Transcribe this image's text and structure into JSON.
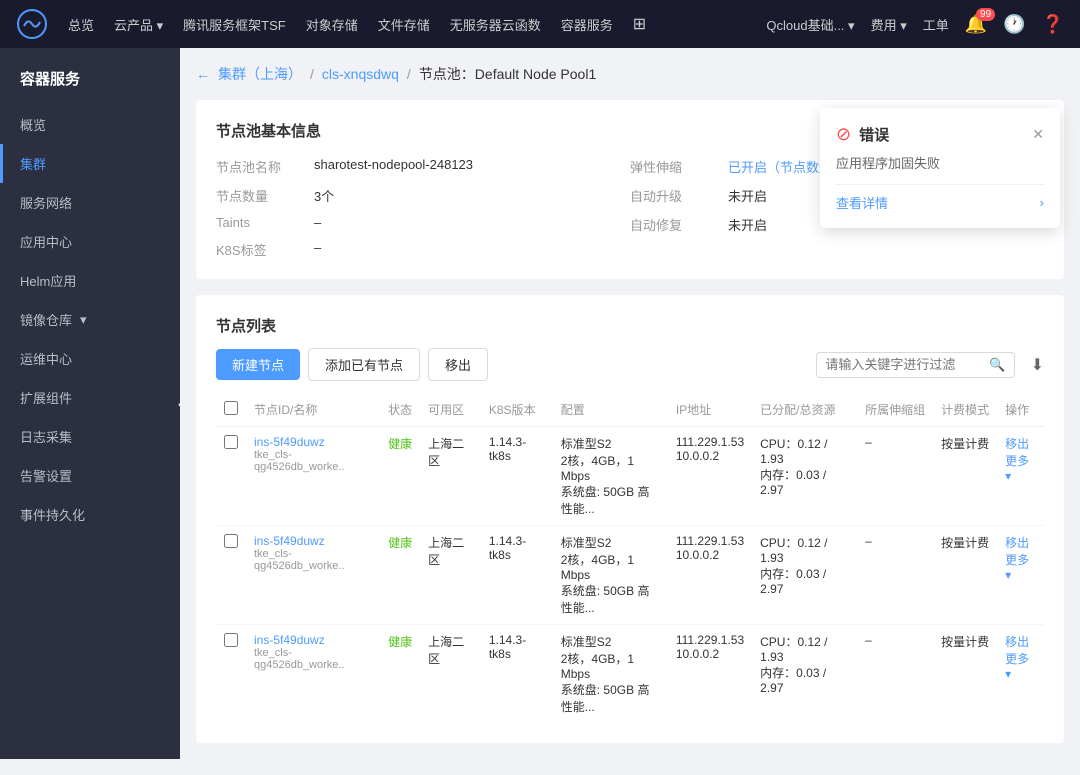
{
  "topnav": {
    "logo_text": "☁",
    "items": [
      "总览",
      "云产品",
      "腾讯服务框架TSF",
      "对象存储",
      "文件存储",
      "无服务器云函数",
      "容器服务"
    ],
    "cloud_item": "云产品",
    "account": "Qcloud基础...",
    "cost": "费用",
    "tools": "工单",
    "notification_count": "99"
  },
  "sidebar": {
    "title": "容器服务",
    "items": [
      {
        "label": "概览",
        "active": false
      },
      {
        "label": "集群",
        "active": true
      },
      {
        "label": "服务网络",
        "active": false
      },
      {
        "label": "应用中心",
        "active": false
      },
      {
        "label": "Helm应用",
        "active": false
      },
      {
        "label": "镜像仓库",
        "active": false,
        "has_arrow": true
      },
      {
        "label": "运维中心",
        "active": false
      },
      {
        "label": "扩展组件",
        "active": false
      },
      {
        "label": "日志采集",
        "active": false
      },
      {
        "label": "告警设置",
        "active": false
      },
      {
        "label": "事件持久化",
        "active": false
      }
    ]
  },
  "breadcrumb": {
    "back": "←",
    "cluster": "集群（上海）",
    "sep1": "/",
    "pool_id": "cls-xnqsdwq",
    "sep2": "/",
    "current": "节点池：Default Node Pool1"
  },
  "node_pool_info": {
    "section_title": "节点池基本信息",
    "fields": [
      {
        "label": "节点池名称",
        "value": "sharotest-nodepool-248123"
      },
      {
        "label": "节点数量",
        "value": "3个"
      },
      {
        "label": "Taints",
        "value": "–"
      },
      {
        "label": "K8S标签",
        "value": "–"
      }
    ],
    "right_fields": [
      {
        "label": "弹性伸缩",
        "value": "已开启（节点数量下限 0..."
      },
      {
        "label": "自动升级",
        "value": "未开启"
      },
      {
        "label": "自动修复",
        "value": "未开启"
      }
    ]
  },
  "node_list": {
    "section_title": "节点列表",
    "buttons": {
      "new_node": "新建节点",
      "add_existing": "添加已有节点",
      "migrate": "移出"
    },
    "search_placeholder": "请输入关键字进行过滤",
    "columns": [
      "节点ID/名称",
      "状态",
      "可用区",
      "K8S版本",
      "配置",
      "IP地址",
      "已分配/总资源",
      "所属伸缩组",
      "计费模式",
      "操作"
    ],
    "rows": [
      {
        "id": "ins-5f49duwz",
        "sub": "tke_cls-qg4526db_worke..",
        "status": "健康",
        "zone": "上海二区",
        "k8s_version": "1.14.3-tk8s",
        "config": "标准型S2",
        "config_detail": "2核，4GB，1 Mbps",
        "config_disk": "系统盘: 50GB 高性能...",
        "ip1": "111.229.1.53",
        "ip2": "10.0.0.2",
        "cpu": "CPU：0.12 / 1.93",
        "mem": "内存：0.03 / 2.97",
        "scale_group": "–",
        "billing": "按量计费",
        "actions": [
          "移出",
          "更多"
        ]
      },
      {
        "id": "ins-5f49duwz",
        "sub": "tke_cls-qg4526db_worke..",
        "status": "健康",
        "zone": "上海二区",
        "k8s_version": "1.14.3-tk8s",
        "config": "标准型S2",
        "config_detail": "2核，4GB，1 Mbps",
        "config_disk": "系统盘: 50GB 高性能...",
        "ip1": "111.229.1.53",
        "ip2": "10.0.0.2",
        "cpu": "CPU：0.12 / 1.93",
        "mem": "内存：0.03 / 2.97",
        "scale_group": "–",
        "billing": "按量计费",
        "actions": [
          "移出",
          "更多"
        ]
      },
      {
        "id": "ins-5f49duwz",
        "sub": "tke_cls-qg4526db_worke..",
        "status": "健康",
        "zone": "上海二区",
        "k8s_version": "1.14.3-tk8s",
        "config": "标准型S2",
        "config_detail": "2核，4GB，1 Mbps",
        "config_disk": "系统盘: 50GB 高性能...",
        "ip1": "111.229.1.53",
        "ip2": "10.0.0.2",
        "cpu": "CPU：0.12 / 1.93",
        "mem": "内存：0.03 / 2.97",
        "scale_group": "–",
        "billing": "按量计费",
        "actions": [
          "移出",
          "更多"
        ]
      }
    ]
  },
  "error_popup": {
    "title": "错误",
    "message": "应用程序加固失败",
    "detail_link": "查看详情"
  }
}
